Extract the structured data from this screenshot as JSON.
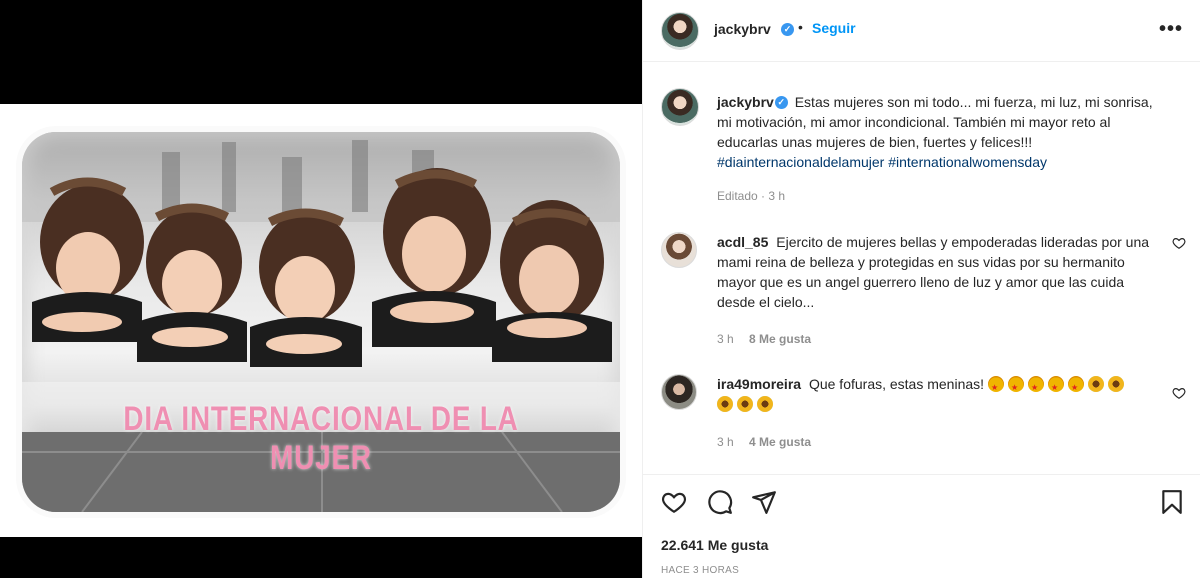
{
  "post": {
    "username": "jackybrv",
    "follow_label": "Seguir",
    "separator": "•",
    "more_label": "•••",
    "image_caption": "DIA INTERNACIONAL DE LA MUJER"
  },
  "caption": {
    "username": "jackybrv",
    "text": "Estas mujeres son mi todo... mi fuerza, mi luz, mi sonrisa, mi motivación, mi amor incondicional. También mi mayor reto al educarlas unas mujeres de bien, fuertes y felices!!!",
    "hashtag1": "#diainternacionaldelamujer",
    "hashtag2": "#internationalwomensday",
    "edited": "Editado · 3 h"
  },
  "comments": [
    {
      "username": "acdl_85",
      "text": "Ejercito de mujeres bellas y empoderadas lideradas por una mami reina de belleza y protegidas en sus vidas por su hermanito mayor que es un angel guerrero lleno de luz y amor que las cuida desde el cielo...",
      "time": "3 h",
      "likes": "8 Me gusta"
    },
    {
      "username": "ira49moreira",
      "text": "Que fofuras, estas meninas!",
      "emojis_line1": [
        "star-struck",
        "star-struck",
        "star-struck",
        "star-struck",
        "star-struck",
        "sunflower",
        "sunflower"
      ],
      "emojis_line2": [
        "sunflower",
        "sunflower",
        "sunflower"
      ],
      "time": "3 h",
      "likes": "4 Me gusta"
    }
  ],
  "footer": {
    "likes_count": "22.641 Me gusta",
    "time_ago": "HACE 3 HORAS"
  },
  "icons": {
    "like": "heart-icon",
    "comment": "comment-icon",
    "share": "share-icon",
    "save": "bookmark-icon"
  },
  "colors": {
    "link_blue": "#0095f6",
    "hashtag": "#00376b",
    "verified": "#3897f0",
    "caption_pink": "#ef8fb2"
  }
}
